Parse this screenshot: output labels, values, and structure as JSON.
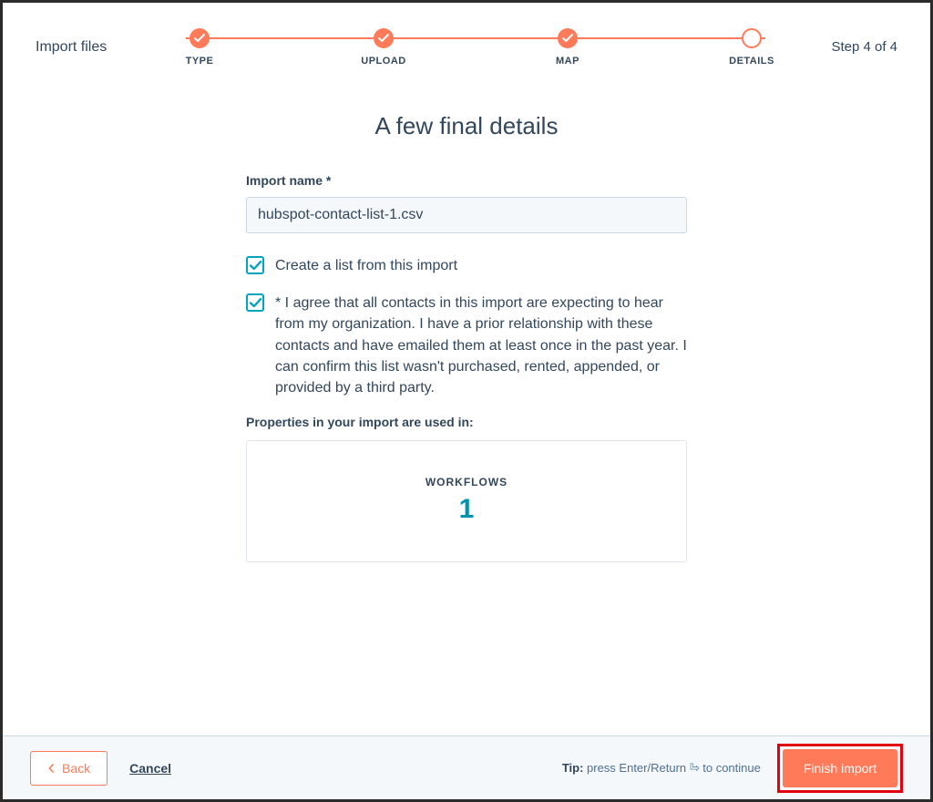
{
  "header": {
    "title": "Import files",
    "step_indicator": "Step 4 of 4",
    "steps": [
      {
        "label": "TYPE",
        "state": "done"
      },
      {
        "label": "UPLOAD",
        "state": "done"
      },
      {
        "label": "MAP",
        "state": "done"
      },
      {
        "label": "DETAILS",
        "state": "current"
      }
    ]
  },
  "main": {
    "heading": "A few final details",
    "import_name_label": "Import name *",
    "import_name_value": "hubspot-contact-list-1.csv",
    "create_list_checkbox": {
      "checked": true,
      "label": "Create a list from this import"
    },
    "consent_checkbox": {
      "checked": true,
      "label": "* I agree that all contacts in this import are expecting to hear from my organization. I have a prior relationship with these contacts and have emailed them at least once in the past year. I can confirm this list wasn't purchased, rented, appended, or provided by a third party."
    },
    "usage_heading": "Properties in your import are used in:",
    "usage_box": {
      "title": "WORKFLOWS",
      "count": "1"
    }
  },
  "footer": {
    "back_label": "Back",
    "cancel_label": "Cancel",
    "tip_prefix": "Tip:",
    "tip_text": " press Enter/Return ",
    "tip_suffix": " to continue",
    "finish_label": "Finish import"
  }
}
